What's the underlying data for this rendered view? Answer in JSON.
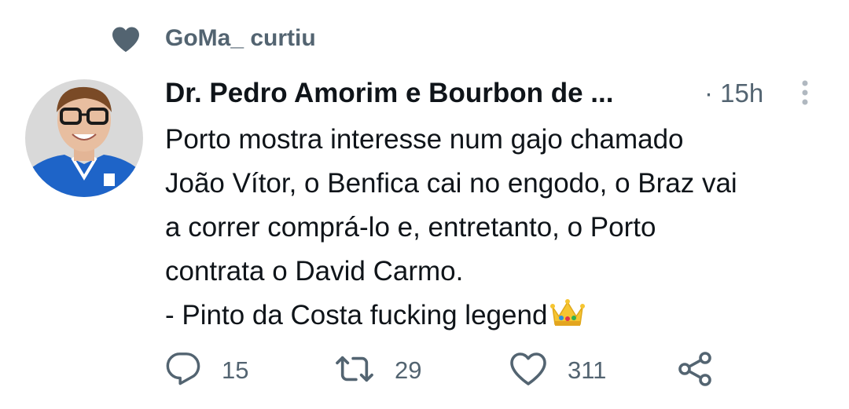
{
  "social_context": {
    "icon": "heart-filled-icon",
    "label": "GoMa_ curtiu"
  },
  "tweet": {
    "author_display_name": "Dr. Pedro Amorim e Bourbon de ...",
    "timestamp": "· 15h",
    "body_lines": [
      "Porto mostra interesse num gajo chamado",
      "João Vítor, o Benfica cai no engodo, o Braz vai",
      "a correr comprá-lo e, entretanto, o Porto",
      "contrata o David Carmo.",
      "- Pinto da Costa fucking legend"
    ],
    "emoji": "crown-emoji"
  },
  "actions": {
    "reply": {
      "icon": "reply-icon",
      "count": "15"
    },
    "retweet": {
      "icon": "retweet-icon",
      "count": "29"
    },
    "like": {
      "icon": "heart-outline-icon",
      "count": "311"
    },
    "share": {
      "icon": "share-icon"
    }
  },
  "colors": {
    "text_primary": "#0f1419",
    "text_secondary": "#536471",
    "background": "#ffffff"
  }
}
